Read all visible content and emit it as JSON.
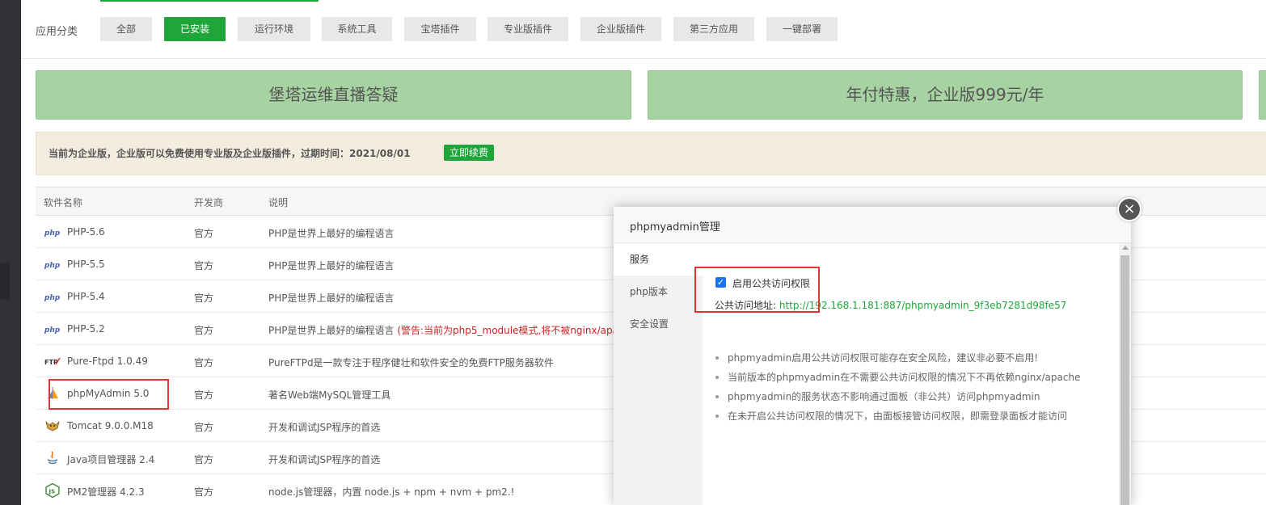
{
  "categories": {
    "label": "应用分类",
    "items": [
      "全部",
      "已安装",
      "运行环境",
      "系统工具",
      "宝塔插件",
      "专业版插件",
      "企业版插件",
      "第三方应用",
      "一键部署"
    ],
    "active_index": 1
  },
  "banners": [
    "堡塔运维直播答疑",
    "年付特惠，企业版999元/年"
  ],
  "notice": {
    "text": "当前为企业版，企业版可以免费使用专业版及企业版插件，过期时间：2021/08/01",
    "button": "立即续费"
  },
  "table": {
    "headers": [
      "软件名称",
      "开发商",
      "说明"
    ],
    "rows": [
      {
        "icon": "php-icon",
        "name": "PHP-5.6",
        "dev": "官方",
        "desc": "PHP是世界上最好的编程语言",
        "warn": ""
      },
      {
        "icon": "php-icon",
        "name": "PHP-5.5",
        "dev": "官方",
        "desc": "PHP是世界上最好的编程语言",
        "warn": ""
      },
      {
        "icon": "php-icon",
        "name": "PHP-5.4",
        "dev": "官方",
        "desc": "PHP是世界上最好的编程语言",
        "warn": ""
      },
      {
        "icon": "php-icon",
        "name": "PHP-5.2",
        "dev": "官方",
        "desc": "PHP是世界上最好的编程语言",
        "warn": "(警告:当前为php5_module模式,将不被nginx/apa"
      },
      {
        "icon": "ftp-icon",
        "name": "Pure-Ftpd 1.0.49",
        "dev": "官方",
        "desc": "PureFTPd是一款专注于程序健壮和软件安全的免费FTP服务器软件",
        "warn": ""
      },
      {
        "icon": "phpmyadmin-icon",
        "name": "phpMyAdmin 5.0",
        "dev": "官方",
        "desc": "著名Web端MySQL管理工具",
        "warn": ""
      },
      {
        "icon": "tomcat-icon",
        "name": "Tomcat 9.0.0.M18",
        "dev": "官方",
        "desc": "开发和调试JSP程序的首选",
        "warn": ""
      },
      {
        "icon": "java-icon",
        "name": "Java项目管理器 2.4",
        "dev": "官方",
        "desc": "开发和调试JSP程序的首选",
        "warn": ""
      },
      {
        "icon": "nodejs-icon",
        "name": "PM2管理器 4.2.3",
        "dev": "官方",
        "desc": "node.js管理器，内置 node.js + npm + nvm + pm2.!",
        "warn": ""
      }
    ]
  },
  "modal": {
    "title": "phpmyadmin管理",
    "close_icon": "×",
    "tabs": [
      "服务",
      "php版本",
      "安全设置"
    ],
    "active_tab": 0,
    "checkbox_label": "启用公共访问权限",
    "checkbox_checked": true,
    "url_label": "公共访问地址: ",
    "url": "http://192.168.1.181:887/phpmyadmin_9f3eb7281d98fe57",
    "tips": [
      "phpmyadmin启用公共访问权限可能存在安全风险，建议非必要不启用!",
      "当前版本的phpmyadmin在不需要公共访问权限的情况下不再依赖nginx/apache",
      "phpmyadmin的服务状态不影响通过面板（非公共）访问phpmyadmin",
      "在未开启公共访问权限的情况下，由面板接管访问权限，即需登录面板才能访问"
    ]
  },
  "colors": {
    "accent": "#20a53a",
    "banner": "#a7d2a2",
    "highlight": "#e03333",
    "warning": "#cc2222"
  }
}
